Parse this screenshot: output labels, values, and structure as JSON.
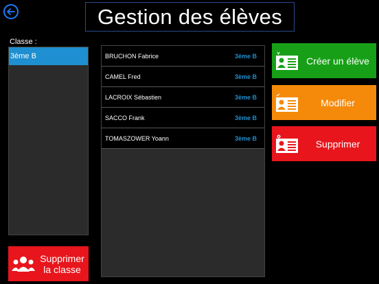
{
  "header": {
    "title": "Gestion des élèves",
    "back_icon": "back-arrow-icon"
  },
  "classes": {
    "label": "Classe :",
    "items": [
      {
        "label": "3ème B",
        "selected": true
      }
    ]
  },
  "students": [
    {
      "name": "BRUCHON Fabrice",
      "class": "3ème B"
    },
    {
      "name": "CAMEL Fred",
      "class": "3ème B"
    },
    {
      "name": "LACROIX Sébastien",
      "class": "3ème B"
    },
    {
      "name": "SACCO Frank",
      "class": "3ème B"
    },
    {
      "name": "TOMASZOWER Yoann",
      "class": "3ème B"
    }
  ],
  "actions": {
    "create_label": "Créer un élève",
    "modify_label": "Modifier",
    "delete_label": "Supprimer"
  },
  "delete_class": {
    "line1": "Supprimer",
    "line2": "la classe"
  },
  "colors": {
    "accent_blue": "#1e8fd0",
    "create_green": "#17a017",
    "modify_orange": "#f58a0a",
    "delete_red": "#e8151c"
  }
}
